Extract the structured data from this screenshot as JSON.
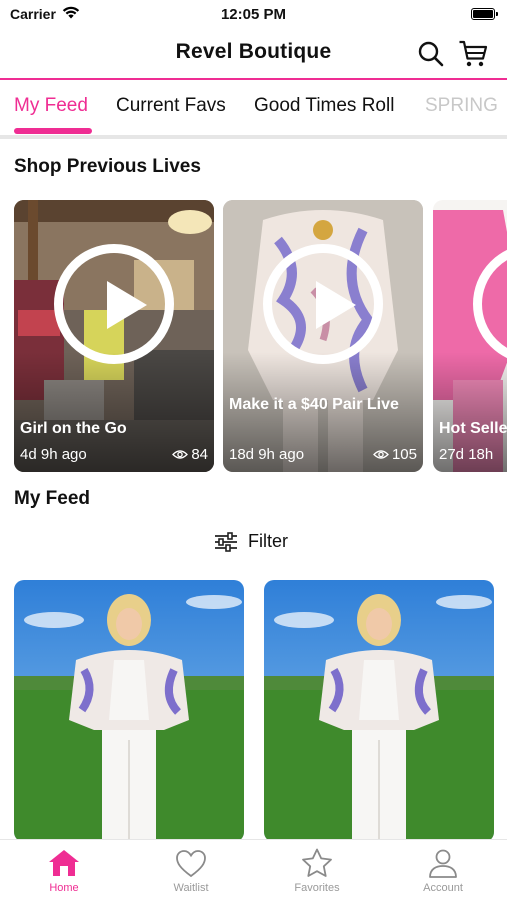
{
  "status_bar": {
    "carrier": "Carrier",
    "time": "12:05 PM"
  },
  "header": {
    "title": "Revel Boutique"
  },
  "tabs": [
    {
      "label": "My Feed",
      "active": true
    },
    {
      "label": "Current Favs",
      "active": false
    },
    {
      "label": "Good Times Roll",
      "active": false
    },
    {
      "label": "SPRING",
      "active": false
    }
  ],
  "previous_lives": {
    "title": "Shop Previous Lives",
    "items": [
      {
        "name": "Girl on the Go",
        "age": "4d 9h ago",
        "views": "84"
      },
      {
        "name": "Make it a $40 Pair Live",
        "age": "18d 9h ago",
        "views": "105"
      },
      {
        "name": "Hot Selle",
        "age": "27d 18h",
        "views": ""
      }
    ]
  },
  "feed": {
    "title": "My Feed",
    "filter_label": "Filter"
  },
  "tab_bar": [
    {
      "label": "Home",
      "icon": "home-icon",
      "active": true
    },
    {
      "label": "Waitlist",
      "icon": "heart-icon",
      "active": false
    },
    {
      "label": "Favorites",
      "icon": "star-icon",
      "active": false
    },
    {
      "label": "Account",
      "icon": "person-icon",
      "active": false
    }
  ],
  "colors": {
    "accent": "#ef2d93",
    "inactive": "#9a9a9a",
    "divider": "#e6e6e6"
  }
}
